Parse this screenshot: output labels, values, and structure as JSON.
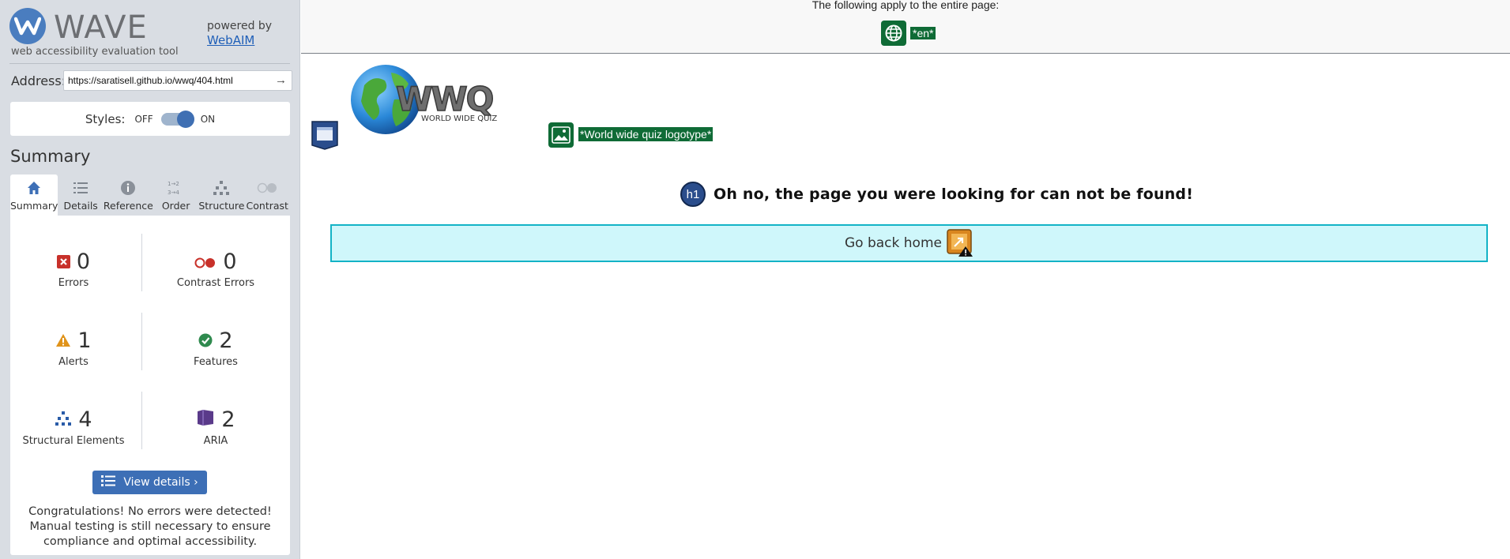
{
  "sidebar": {
    "logo_word": "WAVE",
    "tagline": "web accessibility evaluation tool",
    "powered_by": "powered by",
    "powered_link": "WebAIM",
    "address_label": "Address:",
    "address_value": "https://saratisell.github.io/wwq/404.html",
    "styles_label": "Styles:",
    "styles_off": "OFF",
    "styles_on": "ON",
    "summary_heading": "Summary",
    "tabs": [
      {
        "label": "Summary",
        "icon": "home-icon",
        "active": true
      },
      {
        "label": "Details",
        "icon": "list-icon"
      },
      {
        "label": "Reference",
        "icon": "info-icon"
      },
      {
        "label": "Order",
        "icon": "order-icon"
      },
      {
        "label": "Structure",
        "icon": "structure-icon"
      },
      {
        "label": "Contrast",
        "icon": "contrast-icon"
      }
    ],
    "stats": {
      "errors": {
        "value": "0",
        "label": "Errors",
        "color": "#c8312a"
      },
      "contrast_errors": {
        "value": "0",
        "label": "Contrast Errors",
        "color": "#c8312a"
      },
      "alerts": {
        "value": "1",
        "label": "Alerts",
        "color": "#e0931a"
      },
      "features": {
        "value": "2",
        "label": "Features",
        "color": "#2f8a4e"
      },
      "structural": {
        "value": "4",
        "label": "Structural Elements",
        "color": "#2a5ca8"
      },
      "aria": {
        "value": "2",
        "label": "ARIA",
        "color": "#5a3a8a"
      }
    },
    "view_details": "View details ›",
    "congrats": "Congratulations! No errors were detected! Manual testing is still necessary to ensure compliance and optimal accessibility."
  },
  "main": {
    "page_bar_title": "The following apply to the entire page:",
    "lang_tag": "*en*",
    "logo_main": "WWQ",
    "logo_sub": "WORLD WIDE QUIZ",
    "alt_tag": "*World wide quiz logotype*",
    "h1_badge": "h1",
    "heading": "Oh no, the page you were looking for can not be found!",
    "back_link": "Go back home"
  }
}
